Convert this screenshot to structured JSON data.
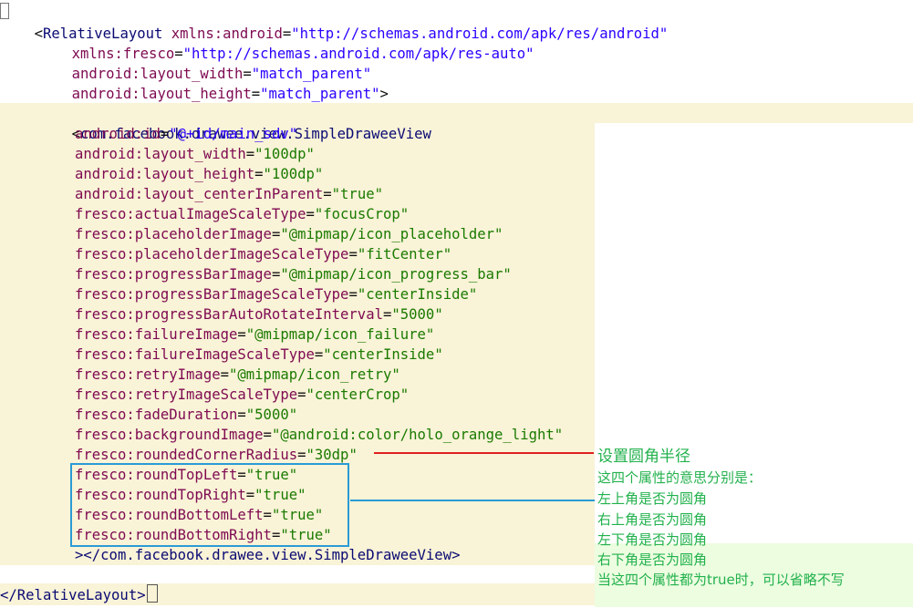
{
  "code": {
    "line1": {
      "open": "<",
      "tag": "RelativeLayout",
      "attr": " xmlns:android",
      "eq": "=",
      "val": "\"http://schemas.android.com/apk/res/android\""
    },
    "line2": {
      "attr": "xmlns:fresco",
      "eq": "=",
      "val": "\"http://schemas.android.com/apk/res-auto\""
    },
    "line3": {
      "attr": "android:layout_width",
      "eq": "=",
      "val": "\"match_parent\""
    },
    "line4": {
      "attr": "android:layout_height",
      "eq": "=",
      "val": "\"match_parent\"",
      "close": ">"
    },
    "line6": {
      "open": "<",
      "tag": "com.facebook.drawee.view.SimpleDraweeView"
    },
    "attrs": [
      {
        "attr": "android:id",
        "val": "\"@+id/main_sdv\""
      },
      {
        "attr": "android:layout_width",
        "val": "\"100dp\""
      },
      {
        "attr": "android:layout_height",
        "val": "\"100dp\""
      },
      {
        "attr": "android:layout_centerInParent",
        "val": "\"true\""
      },
      {
        "attr": "fresco:actualImageScaleType",
        "val": "\"focusCrop\""
      },
      {
        "attr": "fresco:placeholderImage",
        "val": "\"@mipmap/icon_placeholder\""
      },
      {
        "attr": "fresco:placeholderImageScaleType",
        "val": "\"fitCenter\""
      },
      {
        "attr": "fresco:progressBarImage",
        "val": "\"@mipmap/icon_progress_bar\""
      },
      {
        "attr": "fresco:progressBarImageScaleType",
        "val": "\"centerInside\""
      },
      {
        "attr": "fresco:progressBarAutoRotateInterval",
        "val": "\"5000\""
      },
      {
        "attr": "fresco:failureImage",
        "val": "\"@mipmap/icon_failure\""
      },
      {
        "attr": "fresco:failureImageScaleType",
        "val": "\"centerInside\""
      },
      {
        "attr": "fresco:retryImage",
        "val": "\"@mipmap/icon_retry\""
      },
      {
        "attr": "fresco:retryImageScaleType",
        "val": "\"centerCrop\""
      },
      {
        "attr": "fresco:fadeDuration",
        "val": "\"5000\""
      },
      {
        "attr": "fresco:backgroundImage",
        "val": "\"@android:color/holo_orange_light\""
      },
      {
        "attr": "fresco:roundedCornerRadius",
        "val": "\"30dp\""
      },
      {
        "attr": "fresco:roundTopLeft",
        "val": "\"true\""
      },
      {
        "attr": "fresco:roundTopRight",
        "val": "\"true\""
      },
      {
        "attr": "fresco:roundBottomLeft",
        "val": "\"true\""
      },
      {
        "attr": "fresco:roundBottomRight",
        "val": "\"true\""
      }
    ],
    "closing_tag": "></com.facebook.drawee.view.SimpleDraweeView>",
    "end_tag": "</RelativeLayout>"
  },
  "annotations": {
    "title": "设置圆角半径",
    "line1": "这四个属性的意思分别是：",
    "line2": "左上角是否为圆角",
    "line3": "右上角是否为圆角",
    "line4": "左下角是否为圆角",
    "line5": "右下角是否为圆角",
    "line6": "当这四个属性都为true时，可以省略不写"
  },
  "colors": {
    "highlight": "#f9f3d7",
    "annotation_green": "#22b14c",
    "red_line": "#e02020",
    "blue_box": "#2a9bd6"
  }
}
